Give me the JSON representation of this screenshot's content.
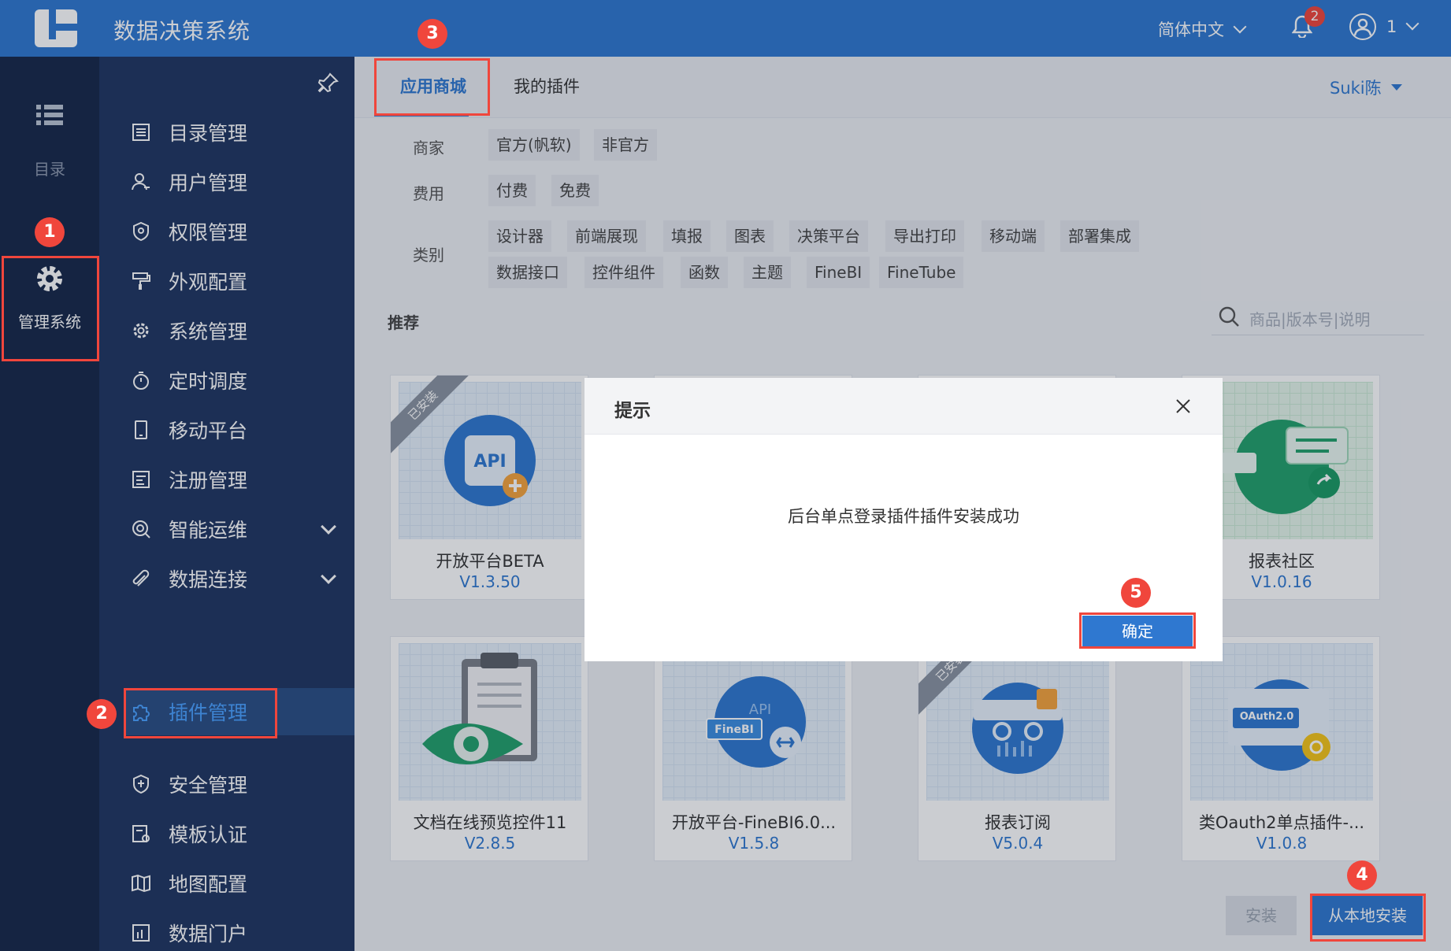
{
  "header": {
    "title": "数据决策系统",
    "language": "简体中文",
    "notification_count": "2",
    "user": "1"
  },
  "rail": {
    "catalog": "目录",
    "admin": "管理系统"
  },
  "sidebar": {
    "items": [
      {
        "label": "目录管理",
        "icon": "list-icon"
      },
      {
        "label": "用户管理",
        "icon": "user-icon"
      },
      {
        "label": "权限管理",
        "icon": "shield-icon"
      },
      {
        "label": "外观配置",
        "icon": "brush-icon"
      },
      {
        "label": "系统管理",
        "icon": "gear-icon"
      },
      {
        "label": "定时调度",
        "icon": "timer-icon"
      },
      {
        "label": "移动平台",
        "icon": "phone-icon"
      },
      {
        "label": "注册管理",
        "icon": "register-icon"
      },
      {
        "label": "智能运维",
        "icon": "ops-icon"
      },
      {
        "label": "数据连接",
        "icon": "link-icon"
      },
      {
        "label": "插件管理",
        "icon": "puzzle-icon"
      },
      {
        "label": "安全管理",
        "icon": "security-icon"
      },
      {
        "label": "模板认证",
        "icon": "certify-icon"
      },
      {
        "label": "地图配置",
        "icon": "map-icon"
      },
      {
        "label": "数据门户",
        "icon": "portal-icon"
      }
    ]
  },
  "tabs": {
    "store": "应用商城",
    "mine": "我的插件",
    "account": "Suki陈"
  },
  "filters": {
    "vendor_label": "商家",
    "vendor": [
      "官方(帆软)",
      "非官方"
    ],
    "fee_label": "费用",
    "fee": [
      "付费",
      "免费"
    ],
    "category_label": "类别",
    "category_row1": [
      "设计器",
      "前端展现",
      "填报",
      "图表",
      "决策平台",
      "导出打印",
      "移动端",
      "部署集成"
    ],
    "category_row2": [
      "数据接口",
      "控件组件",
      "函数",
      "主题",
      "FineBI",
      "FineTube"
    ]
  },
  "recommend": "推荐",
  "search_placeholder": "商品|版本号|说明",
  "cards": [
    {
      "name": "开放平台BETA",
      "version": "V1.3.50",
      "installed": "已安装"
    },
    {
      "name": "报表社区",
      "version": "V1.0.16"
    },
    {
      "name": "文档在线预览控件11",
      "version": "V2.8.5"
    },
    {
      "name": "开放平台-FineBI6.0...",
      "version": "V1.5.8",
      "thumb_label": "FineBI"
    },
    {
      "name": "报表订阅",
      "version": "V5.0.4",
      "installed": "已安装"
    },
    {
      "name": "类Oauth2单点插件-...",
      "version": "V1.0.8",
      "thumb_label": "OAuth2.0"
    }
  ],
  "buttons": {
    "install": "安装",
    "install_local": "从本地安装"
  },
  "dialog": {
    "title": "提示",
    "message": "后台单点登录插件插件安装成功",
    "ok": "确定"
  },
  "callouts": [
    "1",
    "2",
    "3",
    "4",
    "5"
  ],
  "colors": {
    "primary": "#2f78d0",
    "highlight": "#f0463c",
    "sidebar": "#1f3560"
  }
}
